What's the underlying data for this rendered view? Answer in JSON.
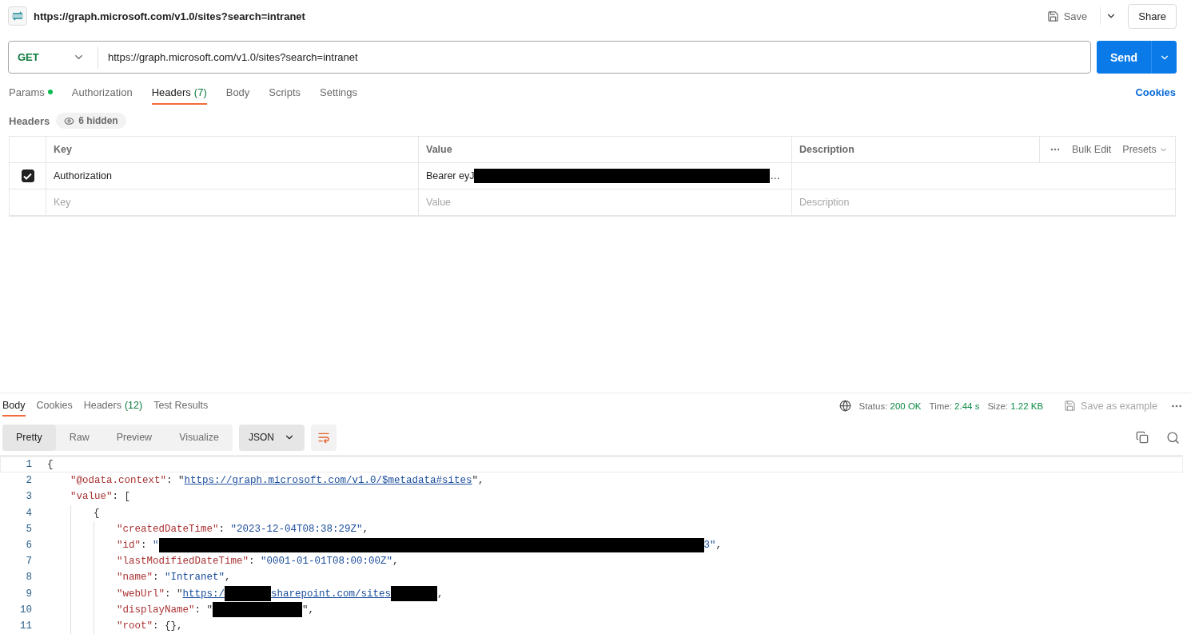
{
  "request": {
    "title": "https://graph.microsoft.com/v1.0/sites?search=intranet",
    "save": "Save",
    "share": "Share",
    "method": "GET",
    "url": "https://graph.microsoft.com/v1.0/sites?search=intranet",
    "send": "Send"
  },
  "tabs": [
    {
      "label": "Params",
      "dot": true,
      "selected": false
    },
    {
      "label": "Authorization",
      "dot": false,
      "selected": false
    },
    {
      "label": "Headers",
      "count": "(7)",
      "dot": false,
      "selected": true
    },
    {
      "label": "Body",
      "dot": false,
      "selected": false
    },
    {
      "label": "Scripts",
      "dot": false,
      "selected": false
    },
    {
      "label": "Settings",
      "dot": false,
      "selected": false
    }
  ],
  "cookies_link": "Cookies",
  "headers": {
    "label": "Headers",
    "hidden": "6 hidden",
    "columns": [
      "Key",
      "Value",
      "Description"
    ],
    "bulk_edit": "Bulk Edit",
    "presets": "Presets",
    "rows": [
      {
        "checked": true,
        "key": "Authorization",
        "value": "Bearer eyJ",
        "value_redacted": true,
        "value_tail": "…"
      }
    ],
    "placeholder": {
      "key": "Key",
      "value": "Value",
      "description": "Description"
    }
  },
  "response": {
    "tabs": [
      {
        "label": "Body",
        "selected": true
      },
      {
        "label": "Cookies",
        "selected": false
      },
      {
        "label": "Headers",
        "count": "(12)",
        "selected": false
      },
      {
        "label": "Test Results",
        "selected": false
      }
    ],
    "status_label": "Status:",
    "status": "200 OK",
    "time_label": "Time:",
    "time": "2.44 s",
    "size_label": "Size:",
    "size": "1.22 KB",
    "save_example": "Save as example",
    "views": [
      {
        "label": "Pretty",
        "selected": true
      },
      {
        "label": "Raw",
        "selected": false
      },
      {
        "label": "Preview",
        "selected": false
      },
      {
        "label": "Visualize",
        "selected": false
      }
    ],
    "format": "JSON",
    "lines": [
      {
        "number": "1",
        "tokens": [
          {
            "kind": "punct",
            "text": "{"
          }
        ],
        "children": [
          {
            "number": "2",
            "tokens": [
              {
                "kind": "key",
                "text": "\"@odata.context\""
              },
              {
                "kind": "punct",
                "text": ": \""
              },
              {
                "kind": "link",
                "text": "https://graph.microsoft.com/v1.0/$metadata#sites"
              },
              {
                "kind": "punct",
                "text": "\","
              }
            ]
          },
          {
            "number": "3",
            "tokens": [
              {
                "kind": "key",
                "text": "\"value\""
              },
              {
                "kind": "punct",
                "text": ": ["
              }
            ],
            "children": [
              {
                "number": "4",
                "tokens": [
                  {
                    "kind": "punct",
                    "text": "{"
                  }
                ],
                "children": [
                  {
                    "number": "5",
                    "tokens": [
                      {
                        "kind": "key",
                        "text": "\"createdDateTime\""
                      },
                      {
                        "kind": "punct",
                        "text": ": "
                      },
                      {
                        "kind": "string",
                        "text": "\"2023-12-04T08:38:29Z\""
                      },
                      {
                        "kind": "punct",
                        "text": ","
                      }
                    ]
                  },
                  {
                    "number": "6",
                    "tokens": [
                      {
                        "kind": "key",
                        "text": "\"id\""
                      },
                      {
                        "kind": "punct",
                        "text": ": "
                      },
                      {
                        "kind": "string",
                        "text": "\""
                      },
                      {
                        "kind": "longmask"
                      },
                      {
                        "kind": "string",
                        "text": "3\""
                      },
                      {
                        "kind": "punct",
                        "text": ","
                      }
                    ]
                  },
                  {
                    "number": "7",
                    "tokens": [
                      {
                        "kind": "key",
                        "text": "\"lastModifiedDateTime\""
                      },
                      {
                        "kind": "punct",
                        "text": ": "
                      },
                      {
                        "kind": "string",
                        "text": "\"0001-01-01T08:00:00Z\""
                      },
                      {
                        "kind": "punct",
                        "text": ","
                      }
                    ]
                  },
                  {
                    "number": "8",
                    "tokens": [
                      {
                        "kind": "key",
                        "text": "\"name\""
                      },
                      {
                        "kind": "punct",
                        "text": ": "
                      },
                      {
                        "kind": "string",
                        "text": "\"Intranet\""
                      },
                      {
                        "kind": "punct",
                        "text": ","
                      }
                    ]
                  },
                  {
                    "number": "9",
                    "tokens": [
                      {
                        "kind": "key",
                        "text": "\"webUrl\""
                      },
                      {
                        "kind": "punct",
                        "text": ": \""
                      },
                      {
                        "kind": "link",
                        "text": "https:/"
                      },
                      {
                        "kind": "shortmask"
                      },
                      {
                        "kind": "link",
                        "text": "sharepoint.com/sites"
                      },
                      {
                        "kind": "shortmask"
                      },
                      {
                        "kind": "punct",
                        "text": ","
                      }
                    ]
                  },
                  {
                    "number": "10",
                    "tokens": [
                      {
                        "kind": "key",
                        "text": "\"displayName\""
                      },
                      {
                        "kind": "punct",
                        "text": ": \""
                      },
                      {
                        "kind": "mask"
                      },
                      {
                        "kind": "punct",
                        "text": "\","
                      }
                    ]
                  },
                  {
                    "number": "11",
                    "tokens": [
                      {
                        "kind": "key",
                        "text": "\"root\""
                      },
                      {
                        "kind": "punct",
                        "text": ": {},"
                      }
                    ]
                  }
                ]
              }
            ]
          }
        ]
      }
    ]
  }
}
